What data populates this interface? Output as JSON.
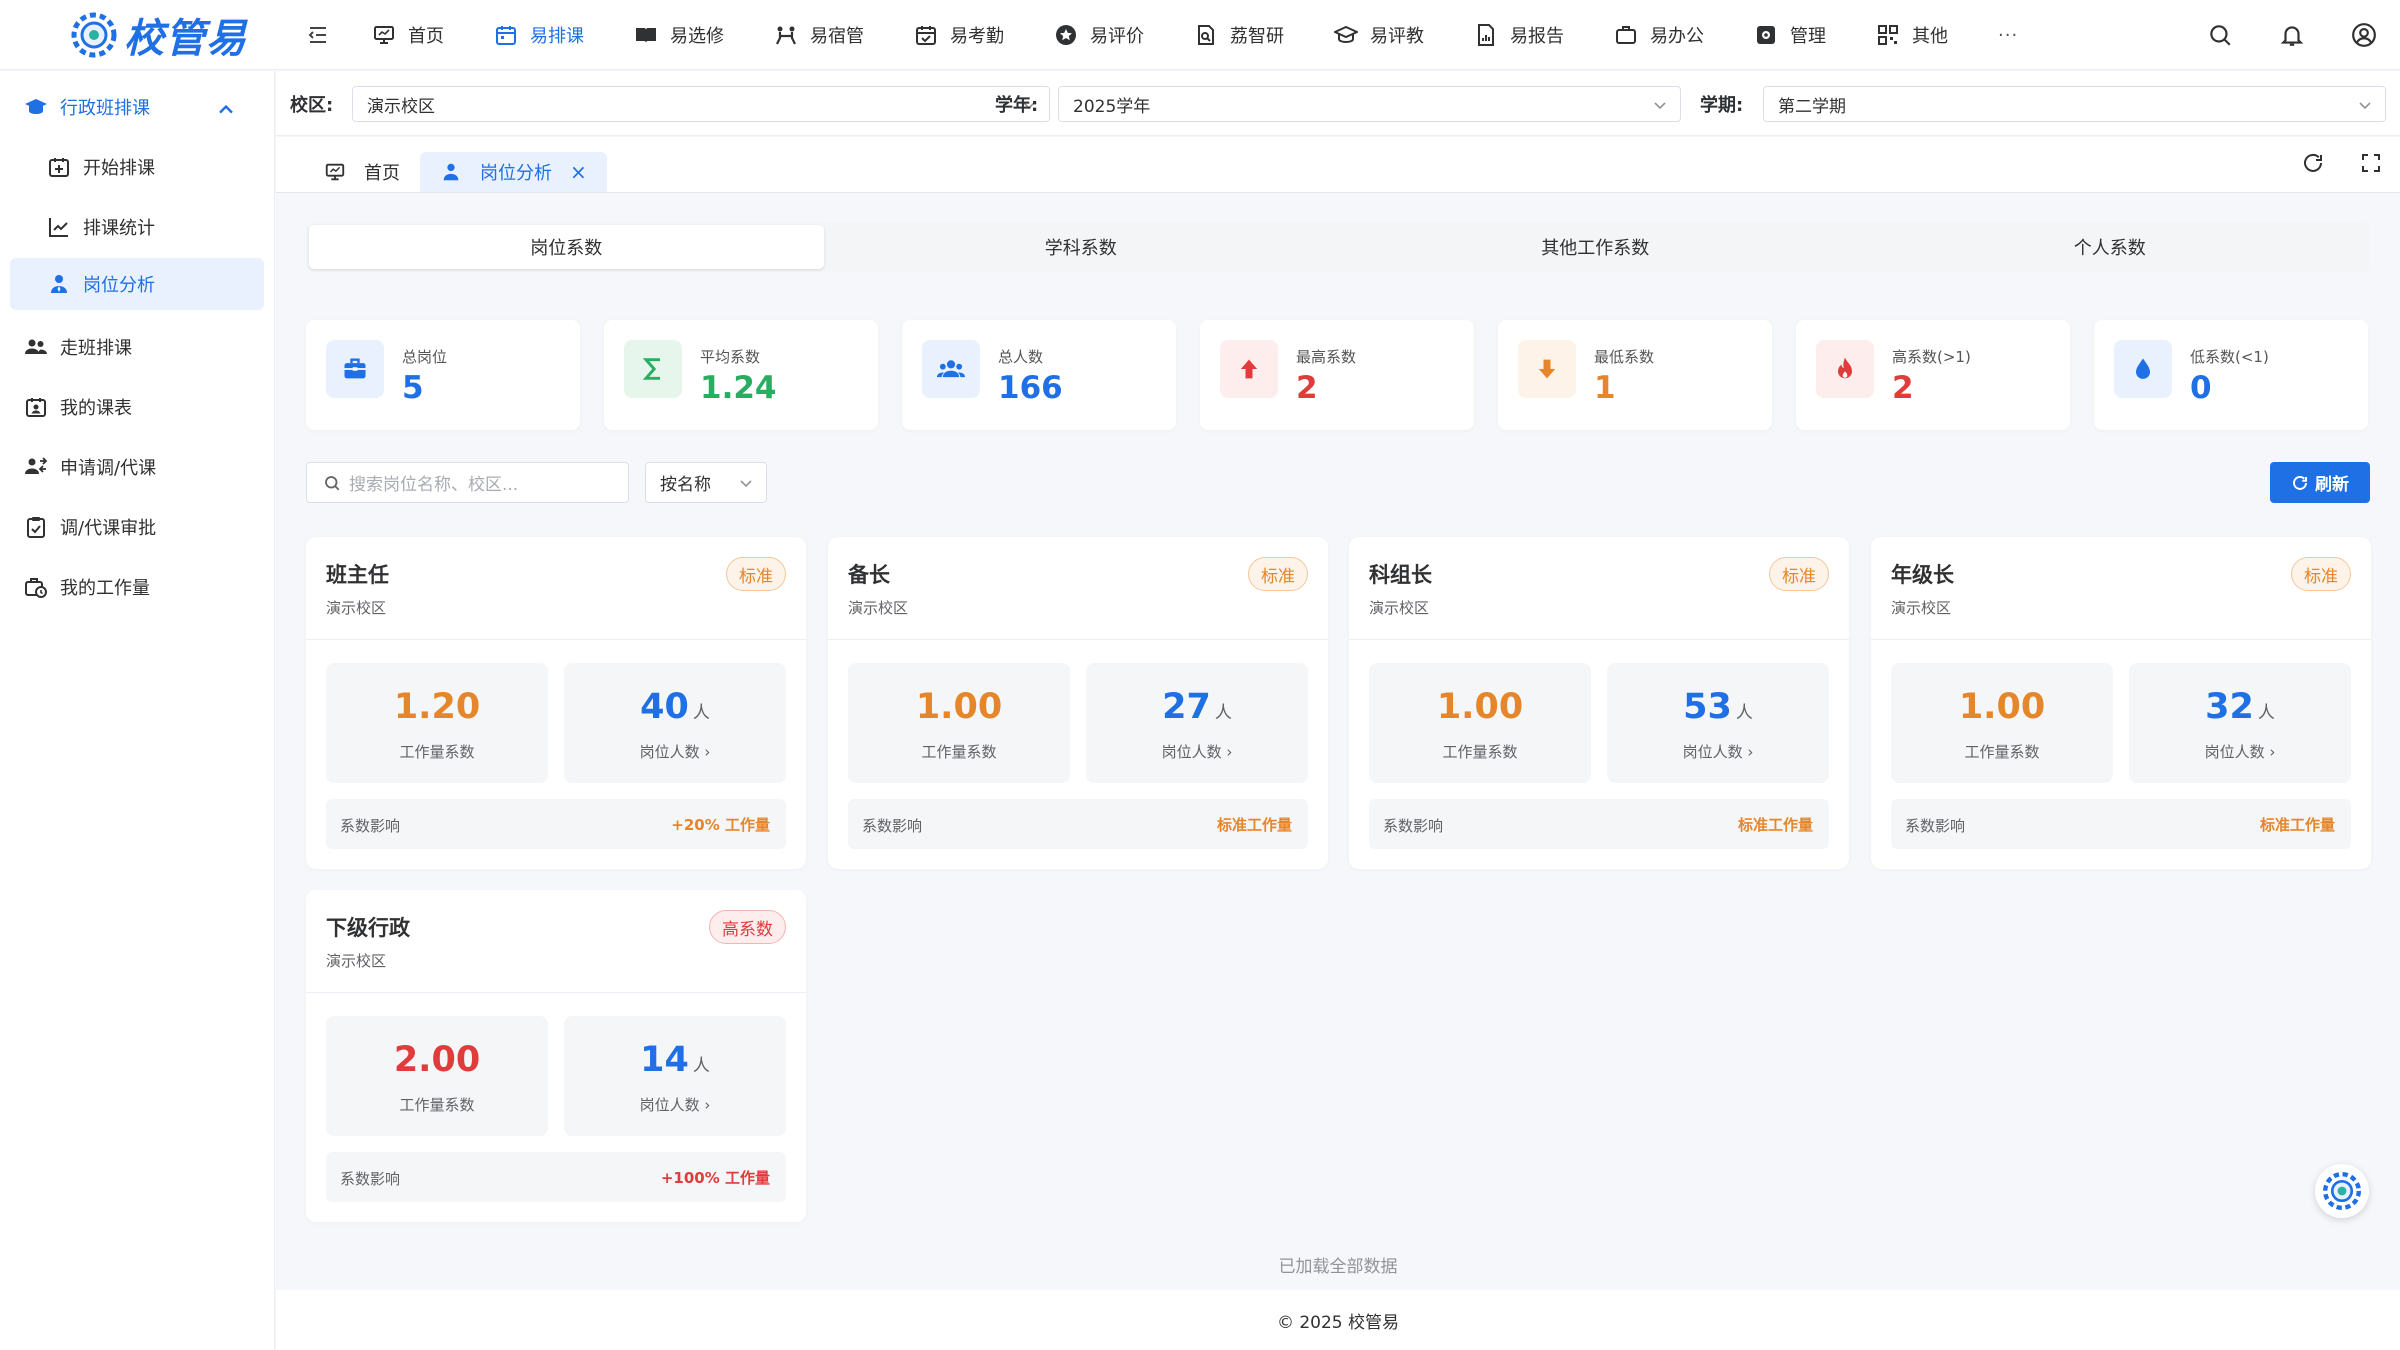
{
  "app": {
    "logo_text": "校管易"
  },
  "nav": [
    {
      "label": "首页",
      "icon": "monitor-icon"
    },
    {
      "label": "易排课",
      "icon": "calendar-icon",
      "active": true
    },
    {
      "label": "易选修",
      "icon": "book-icon"
    },
    {
      "label": "易宿管",
      "icon": "bed-icon"
    },
    {
      "label": "易考勤",
      "icon": "calendar-check-icon"
    },
    {
      "label": "易评价",
      "icon": "star-circle-icon"
    },
    {
      "label": "荔智研",
      "icon": "research-icon"
    },
    {
      "label": "易评教",
      "icon": "graduation-cap-icon"
    },
    {
      "label": "易报告",
      "icon": "report-icon"
    },
    {
      "label": "易办公",
      "icon": "briefcase-icon"
    },
    {
      "label": "管理",
      "icon": "gear-box-icon"
    },
    {
      "label": "其他",
      "icon": "grid-icon"
    }
  ],
  "nav_more": "···",
  "sidebar": {
    "group_label": "行政班排课",
    "items": [
      {
        "label": "开始排课"
      },
      {
        "label": "排课统计"
      },
      {
        "label": "岗位分析",
        "active": true
      },
      {
        "label": "走班排课"
      },
      {
        "label": "我的课表"
      },
      {
        "label": "申请调/代课"
      },
      {
        "label": "调/代课审批"
      },
      {
        "label": "我的工作量"
      }
    ]
  },
  "filters": {
    "campus_label": "校区:",
    "campus_value": "演示校区",
    "year_label": "学年:",
    "year_value": "2025学年",
    "term_label": "学期:",
    "term_value": "第二学期"
  },
  "tabs": [
    {
      "label": "首页"
    },
    {
      "label": "岗位分析",
      "active": true,
      "close": "×"
    }
  ],
  "segments": [
    "岗位系数",
    "学科系数",
    "其他工作系数",
    "个人系数"
  ],
  "stats": [
    {
      "label": "总岗位",
      "value": "5",
      "color": "#1f6fe5",
      "bg": "#e8f1fd",
      "icon": "briefcase-icon"
    },
    {
      "label": "平均系数",
      "value": "1.24",
      "color": "#27ae60",
      "bg": "#e6f6ec",
      "icon": "sigma-icon"
    },
    {
      "label": "总人数",
      "value": "166",
      "color": "#1f6fe5",
      "bg": "#e8f1fd",
      "icon": "users-icon"
    },
    {
      "label": "最高系数",
      "value": "2",
      "color": "#e03c3c",
      "bg": "#fdeded",
      "icon": "arrow-up-icon"
    },
    {
      "label": "最低系数",
      "value": "1",
      "color": "#e6862b",
      "bg": "#fdf3e8",
      "icon": "arrow-down-icon"
    },
    {
      "label": "高系数(>1)",
      "value": "2",
      "color": "#e03c3c",
      "bg": "#fdeded",
      "icon": "flame-icon"
    },
    {
      "label": "低系数(<1)",
      "value": "0",
      "color": "#1f6fe5",
      "bg": "#e8f1fd",
      "icon": "drop-icon"
    }
  ],
  "search": {
    "placeholder": "搜索岗位名称、校区..."
  },
  "sort": {
    "value": "按名称"
  },
  "refresh_label": "刷新",
  "positions": [
    {
      "title": "班主任",
      "campus": "演示校区",
      "badge": "标准",
      "badge_type": "std",
      "coef": "1.20",
      "coef_label": "工作量系数",
      "count": "40",
      "unit": "人",
      "count_label": "岗位人数 ›",
      "impact_label": "系数影响",
      "impact": "+20% 工作量",
      "coef_color": "#e6862b",
      "impact_color": "#e6862b"
    },
    {
      "title": "备长",
      "campus": "演示校区",
      "badge": "标准",
      "badge_type": "std",
      "coef": "1.00",
      "coef_label": "工作量系数",
      "count": "27",
      "unit": "人",
      "count_label": "岗位人数 ›",
      "impact_label": "系数影响",
      "impact": "标准工作量",
      "coef_color": "#e6862b",
      "impact_color": "#e6862b"
    },
    {
      "title": "科组长",
      "campus": "演示校区",
      "badge": "标准",
      "badge_type": "std",
      "coef": "1.00",
      "coef_label": "工作量系数",
      "count": "53",
      "unit": "人",
      "count_label": "岗位人数 ›",
      "impact_label": "系数影响",
      "impact": "标准工作量",
      "coef_color": "#e6862b",
      "impact_color": "#e6862b"
    },
    {
      "title": "年级长",
      "campus": "演示校区",
      "badge": "标准",
      "badge_type": "std",
      "coef": "1.00",
      "coef_label": "工作量系数",
      "count": "32",
      "unit": "人",
      "count_label": "岗位人数 ›",
      "impact_label": "系数影响",
      "impact": "标准工作量",
      "coef_color": "#e6862b",
      "impact_color": "#e6862b"
    },
    {
      "title": "下级行政",
      "campus": "演示校区",
      "badge": "高系数",
      "badge_type": "high",
      "coef": "2.00",
      "coef_label": "工作量系数",
      "count": "14",
      "unit": "人",
      "count_label": "岗位人数 ›",
      "impact_label": "系数影响",
      "impact": "+100% 工作量",
      "coef_color": "#e03c3c",
      "impact_color": "#e03c3c"
    }
  ],
  "count_color": "#1f6fe5",
  "loaded_text": "已加载全部数据",
  "footer_text": "© 2025 校管易"
}
